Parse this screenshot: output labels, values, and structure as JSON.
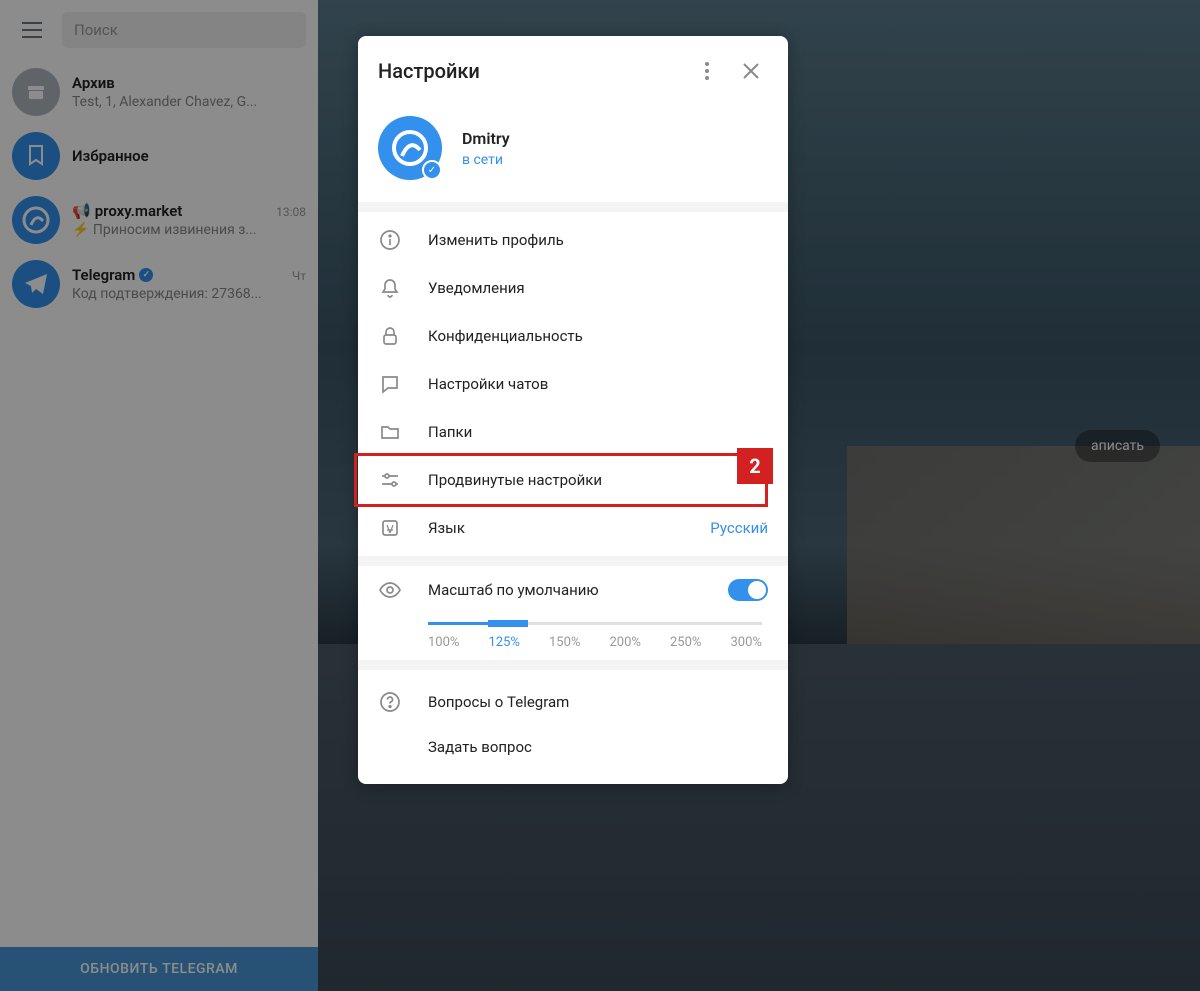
{
  "sidebar": {
    "search_placeholder": "Поиск",
    "chats": [
      {
        "name": "Архив",
        "preview": "Test, 1, Alexander Chavez, G...",
        "time": ""
      },
      {
        "name": "Избранное",
        "preview": "",
        "time": ""
      },
      {
        "name": "proxy.market",
        "preview": "⚡ Приносим извинения з...",
        "time": "13:08",
        "channel": true
      },
      {
        "name": "Telegram",
        "preview": "Код подтверждения: 27368...",
        "time": "Чт",
        "verified": true
      }
    ],
    "update_label": "ОБНОВИТЬ TELEGRAM"
  },
  "main": {
    "write_label": "аписать"
  },
  "settings": {
    "title": "Настройки",
    "profile": {
      "name": "Dmitry",
      "status": "в сети"
    },
    "items": [
      {
        "label": "Изменить профиль"
      },
      {
        "label": "Уведомления"
      },
      {
        "label": "Конфиденциальность"
      },
      {
        "label": "Настройки чатов"
      },
      {
        "label": "Папки"
      },
      {
        "label": "Продвинутые настройки",
        "highlighted": true,
        "badge": "2"
      },
      {
        "label": "Язык",
        "value": "Русский"
      }
    ],
    "scale": {
      "label": "Масштаб по умолчанию",
      "options": [
        "100%",
        "125%",
        "150%",
        "200%",
        "250%",
        "300%"
      ],
      "active": "125%"
    },
    "footer": [
      {
        "label": "Вопросы о Telegram"
      },
      {
        "label": "Задать вопрос"
      }
    ]
  }
}
